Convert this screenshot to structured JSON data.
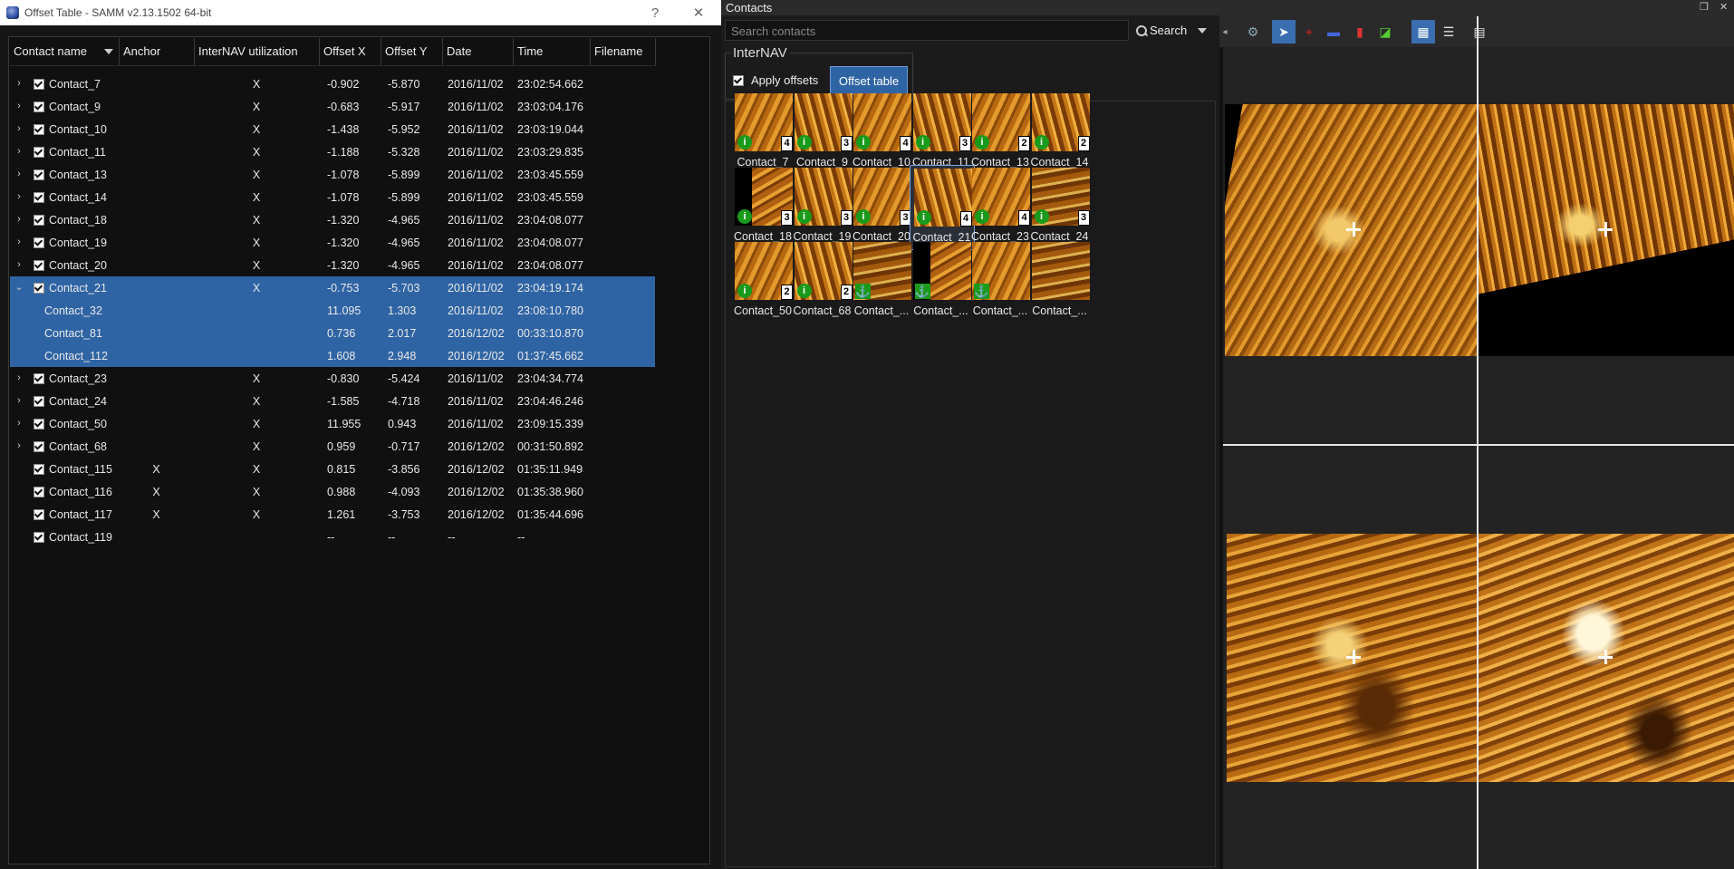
{
  "dialog": {
    "title": "Offset Table - SAMM v2.13.1502 64-bit",
    "help_label": "?",
    "close_label": "✕"
  },
  "table": {
    "columns": [
      "Contact name",
      "Anchor",
      "InterNAV utilization",
      "Offset X",
      "Offset Y",
      "Date",
      "Time",
      "Filename"
    ],
    "rows": [
      {
        "name": "Contact_7",
        "exp": "›",
        "anchor": "",
        "util": "X",
        "ox": "-0.902",
        "oy": "-5.870",
        "date": "2016/11/02",
        "time": "23:02:54.662"
      },
      {
        "name": "Contact_9",
        "exp": "›",
        "anchor": "",
        "util": "X",
        "ox": "-0.683",
        "oy": "-5.917",
        "date": "2016/11/02",
        "time": "23:03:04.176"
      },
      {
        "name": "Contact_10",
        "exp": "›",
        "anchor": "",
        "util": "X",
        "ox": "-1.438",
        "oy": "-5.952",
        "date": "2016/11/02",
        "time": "23:03:19.044"
      },
      {
        "name": "Contact_11",
        "exp": "›",
        "anchor": "",
        "util": "X",
        "ox": "-1.188",
        "oy": "-5.328",
        "date": "2016/11/02",
        "time": "23:03:29.835"
      },
      {
        "name": "Contact_13",
        "exp": "›",
        "anchor": "",
        "util": "X",
        "ox": "-1.078",
        "oy": "-5.899",
        "date": "2016/11/02",
        "time": "23:03:45.559"
      },
      {
        "name": "Contact_14",
        "exp": "›",
        "anchor": "",
        "util": "X",
        "ox": "-1.078",
        "oy": "-5.899",
        "date": "2016/11/02",
        "time": "23:03:45.559"
      },
      {
        "name": "Contact_18",
        "exp": "›",
        "anchor": "",
        "util": "X",
        "ox": "-1.320",
        "oy": "-4.965",
        "date": "2016/11/02",
        "time": "23:04:08.077"
      },
      {
        "name": "Contact_19",
        "exp": "›",
        "anchor": "",
        "util": "X",
        "ox": "-1.320",
        "oy": "-4.965",
        "date": "2016/11/02",
        "time": "23:04:08.077"
      },
      {
        "name": "Contact_20",
        "exp": "›",
        "anchor": "",
        "util": "X",
        "ox": "-1.320",
        "oy": "-4.965",
        "date": "2016/11/02",
        "time": "23:04:08.077"
      },
      {
        "name": "Contact_21",
        "exp": "⌄",
        "anchor": "",
        "util": "X",
        "ox": "-0.753",
        "oy": "-5.703",
        "date": "2016/11/02",
        "time": "23:04:19.174",
        "sel": true
      },
      {
        "name": "Contact_32",
        "child": true,
        "sel": true,
        "anchor": "",
        "util": "",
        "ox": "11.095",
        "oy": "1.303",
        "date": "2016/11/02",
        "time": "23:08:10.780"
      },
      {
        "name": "Contact_81",
        "child": true,
        "sel": true,
        "anchor": "",
        "util": "",
        "ox": "0.736",
        "oy": "2.017",
        "date": "2016/12/02",
        "time": "00:33:10.870"
      },
      {
        "name": "Contact_112",
        "child": true,
        "sel": true,
        "anchor": "",
        "util": "",
        "ox": "1.608",
        "oy": "2.948",
        "date": "2016/12/02",
        "time": "01:37:45.662"
      },
      {
        "name": "Contact_23",
        "exp": "›",
        "anchor": "",
        "util": "X",
        "ox": "-0.830",
        "oy": "-5.424",
        "date": "2016/11/02",
        "time": "23:04:34.774"
      },
      {
        "name": "Contact_24",
        "exp": "›",
        "anchor": "",
        "util": "X",
        "ox": "-1.585",
        "oy": "-4.718",
        "date": "2016/11/02",
        "time": "23:04:46.246"
      },
      {
        "name": "Contact_50",
        "exp": "›",
        "anchor": "",
        "util": "X",
        "ox": "11.955",
        "oy": "0.943",
        "date": "2016/11/02",
        "time": "23:09:15.339"
      },
      {
        "name": "Contact_68",
        "exp": "›",
        "anchor": "",
        "util": "X",
        "ox": "0.959",
        "oy": "-0.717",
        "date": "2016/12/02",
        "time": "00:31:50.892"
      },
      {
        "name": "Contact_115",
        "anchor": "X",
        "util": "X",
        "ox": "0.815",
        "oy": "-3.856",
        "date": "2016/12/02",
        "time": "01:35:11.949"
      },
      {
        "name": "Contact_116",
        "anchor": "X",
        "util": "X",
        "ox": "0.988",
        "oy": "-4.093",
        "date": "2016/12/02",
        "time": "01:35:38.960"
      },
      {
        "name": "Contact_117",
        "anchor": "X",
        "util": "X",
        "ox": "1.261",
        "oy": "-3.753",
        "date": "2016/12/02",
        "time": "01:35:44.696"
      },
      {
        "name": "Contact_119",
        "anchor": "",
        "util": "",
        "ox": "--",
        "oy": "--",
        "date": "--",
        "time": "--"
      }
    ]
  },
  "contacts": {
    "title": "Contacts",
    "search_placeholder": "Search contacts",
    "search_label": "Search",
    "internav_label": "InterNAV",
    "apply_offsets_label": "Apply offsets",
    "offset_table_label": "Offset table",
    "thumbs": [
      {
        "label": "Contact_7",
        "badge": "info",
        "count": "4",
        "v": "v1"
      },
      {
        "label": "Contact_9",
        "badge": "info",
        "count": "3",
        "v": "v2"
      },
      {
        "label": "Contact_10",
        "badge": "info",
        "count": "4",
        "v": "v1"
      },
      {
        "label": "Contact_11",
        "badge": "info",
        "count": "3",
        "v": "v2"
      },
      {
        "label": "Contact_13",
        "badge": "info",
        "count": "2",
        "v": "v1"
      },
      {
        "label": "Contact_14",
        "badge": "info",
        "count": "2",
        "v": "v2"
      },
      {
        "label": "Contact_18",
        "badge": "info",
        "count": "3",
        "v": "v3"
      },
      {
        "label": "Contact_19",
        "badge": "info",
        "count": "3",
        "v": "v2"
      },
      {
        "label": "Contact_20",
        "badge": "info",
        "count": "3",
        "v": "v1"
      },
      {
        "label": "Contact_21",
        "badge": "info",
        "count": "4",
        "v": "v2",
        "sel": true
      },
      {
        "label": "Contact_23",
        "badge": "info",
        "count": "4",
        "v": "v1"
      },
      {
        "label": "Contact_24",
        "badge": "info",
        "count": "3",
        "v": "v4"
      },
      {
        "label": "Contact_50",
        "badge": "info",
        "count": "2",
        "v": "v1"
      },
      {
        "label": "Contact_68",
        "badge": "info",
        "count": "2",
        "v": "v2"
      },
      {
        "label": "Contact_...",
        "badge": "anchor",
        "count": "",
        "v": "v4"
      },
      {
        "label": "Contact_...",
        "badge": "anchor",
        "count": "",
        "v": "v3"
      },
      {
        "label": "Contact_...",
        "badge": "anchor",
        "count": "",
        "v": "v1"
      },
      {
        "label": "Contact_...",
        "badge": "none",
        "count": "",
        "v": "v4"
      }
    ]
  },
  "viewer": {
    "toolbar_icons": [
      "collapse-arrow-icon",
      "globe-icon",
      "pointer-icon",
      "crosshair-icon",
      "flag-icon",
      "marker-icon",
      "measure-icon",
      "grid-2x2-icon",
      "list-view-icon",
      "table-view-icon"
    ]
  }
}
